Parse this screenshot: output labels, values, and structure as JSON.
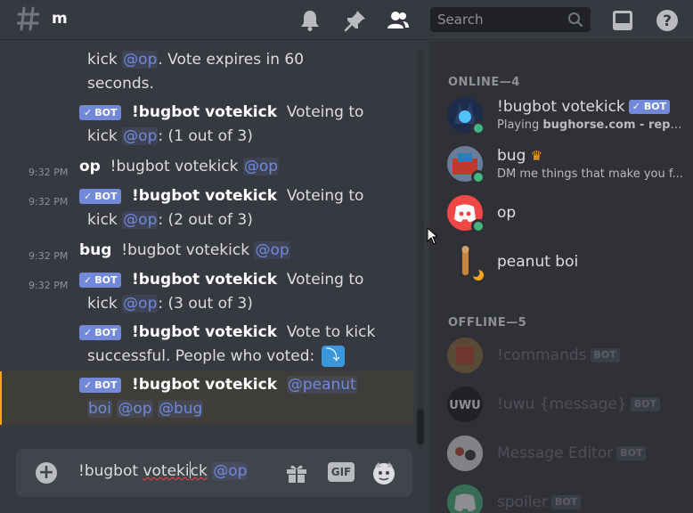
{
  "header": {
    "channel": "m",
    "search_placeholder": "Search"
  },
  "messages": [
    {
      "lines": [
        "kick @op. Vote expires in 60",
        "seconds."
      ]
    },
    {
      "bot_badge": "BOT",
      "author": "!bugbot votekick",
      "text1": "Voteing to",
      "text2_pre": "kick ",
      "mention": "@op",
      "text2_post": ": (1 out of 3)"
    },
    {
      "time": "9:32 PM",
      "author": "op",
      "text": "!bugbot votekick",
      "mention": "@op"
    },
    {
      "time": "9:32 PM",
      "bot_badge": "BOT",
      "author": "!bugbot votekick",
      "text1": "Voteing to",
      "text2_pre": "kick ",
      "mention": "@op",
      "text2_post": ": (2 out of 3)"
    },
    {
      "time": "9:32 PM",
      "author": "bug",
      "text": "!bugbot votekick",
      "mention": "@op"
    },
    {
      "time": "9:32 PM",
      "bot_badge": "BOT",
      "author": "!bugbot votekick",
      "text1": "Voteing to",
      "text2_pre": "kick ",
      "mention": "@op",
      "text2_post": ": (3 out of 3)"
    },
    {
      "bot_badge": "BOT",
      "author": "!bugbot votekick",
      "text1": "Vote to kick",
      "text2": "successful. People who voted:"
    },
    {
      "bot_badge": "BOT",
      "author": "!bugbot votekick",
      "mention1": "@peanut",
      "mention2": "boi",
      "mention3": "@op",
      "mention4": "@bug"
    }
  ],
  "composer": {
    "text_pre": "!bugbot",
    "text_mid": "voteki",
    "text_after_caret": "ck",
    "mention": "@op",
    "gif_label": "GIF"
  },
  "members": {
    "online_title": "ONLINE—4",
    "offline_title": "OFFLINE—5",
    "online": [
      {
        "name": "!bugbot votekick",
        "bot": "BOT",
        "activity_pre": "Playing ",
        "activity_bold": "bughorse.com - report ..."
      },
      {
        "name": "bug",
        "activity": "DM me things that make you f..."
      },
      {
        "name": "op"
      },
      {
        "name": "peanut boi"
      }
    ],
    "offline": [
      {
        "name": "!commands",
        "bot": "BOT"
      },
      {
        "name": "!uwu {message}",
        "bot": "BOT"
      },
      {
        "name": "Message Editor",
        "bot": "BOT"
      },
      {
        "name": "spoiler",
        "bot": "BOT"
      }
    ]
  },
  "colors": {
    "accent": "#7289da",
    "online": "#43b581",
    "highlight_border": "#faa61a"
  }
}
